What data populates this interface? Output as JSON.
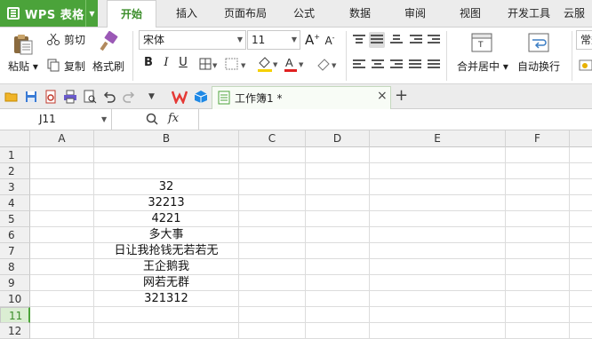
{
  "app": {
    "name": "WPS 表格"
  },
  "menu": [
    "开始",
    "插入",
    "页面布局",
    "公式",
    "数据",
    "审阅",
    "视图",
    "开发工具",
    "云服"
  ],
  "ribbon": {
    "paste": "粘贴",
    "cut": "剪切",
    "copy": "复制",
    "format_painter": "格式刷",
    "font_name": "宋体",
    "font_size": "11",
    "bold": "B",
    "italic": "I",
    "underline": "U",
    "merge_center": "合并居中",
    "wrap_text": "自动换行",
    "number_format": "常规",
    "grow_font": "A",
    "shrink_font": "A"
  },
  "tab": {
    "title": "工作簿1 *",
    "close": "×",
    "new": "+"
  },
  "formula_bar": {
    "cell_ref": "J11",
    "fx": "fx",
    "value": ""
  },
  "columns": [
    "A",
    "B",
    "C",
    "D",
    "E",
    "F"
  ],
  "rows": [
    "1",
    "2",
    "3",
    "4",
    "5",
    "6",
    "7",
    "8",
    "9",
    "10",
    "11",
    "12"
  ],
  "selected_row": "11",
  "cells": {
    "B3": "32",
    "B4": "32213",
    "B5": "4221",
    "B6": "多大事",
    "B7": "日让我抢钱无若若无",
    "B8": "王企鹅我",
    "B9": "网若无群",
    "B10": "321312"
  },
  "colors": {
    "accent": "#4ba33a",
    "menu_bg": "#ececec",
    "header_bg": "#f0f0f0"
  }
}
